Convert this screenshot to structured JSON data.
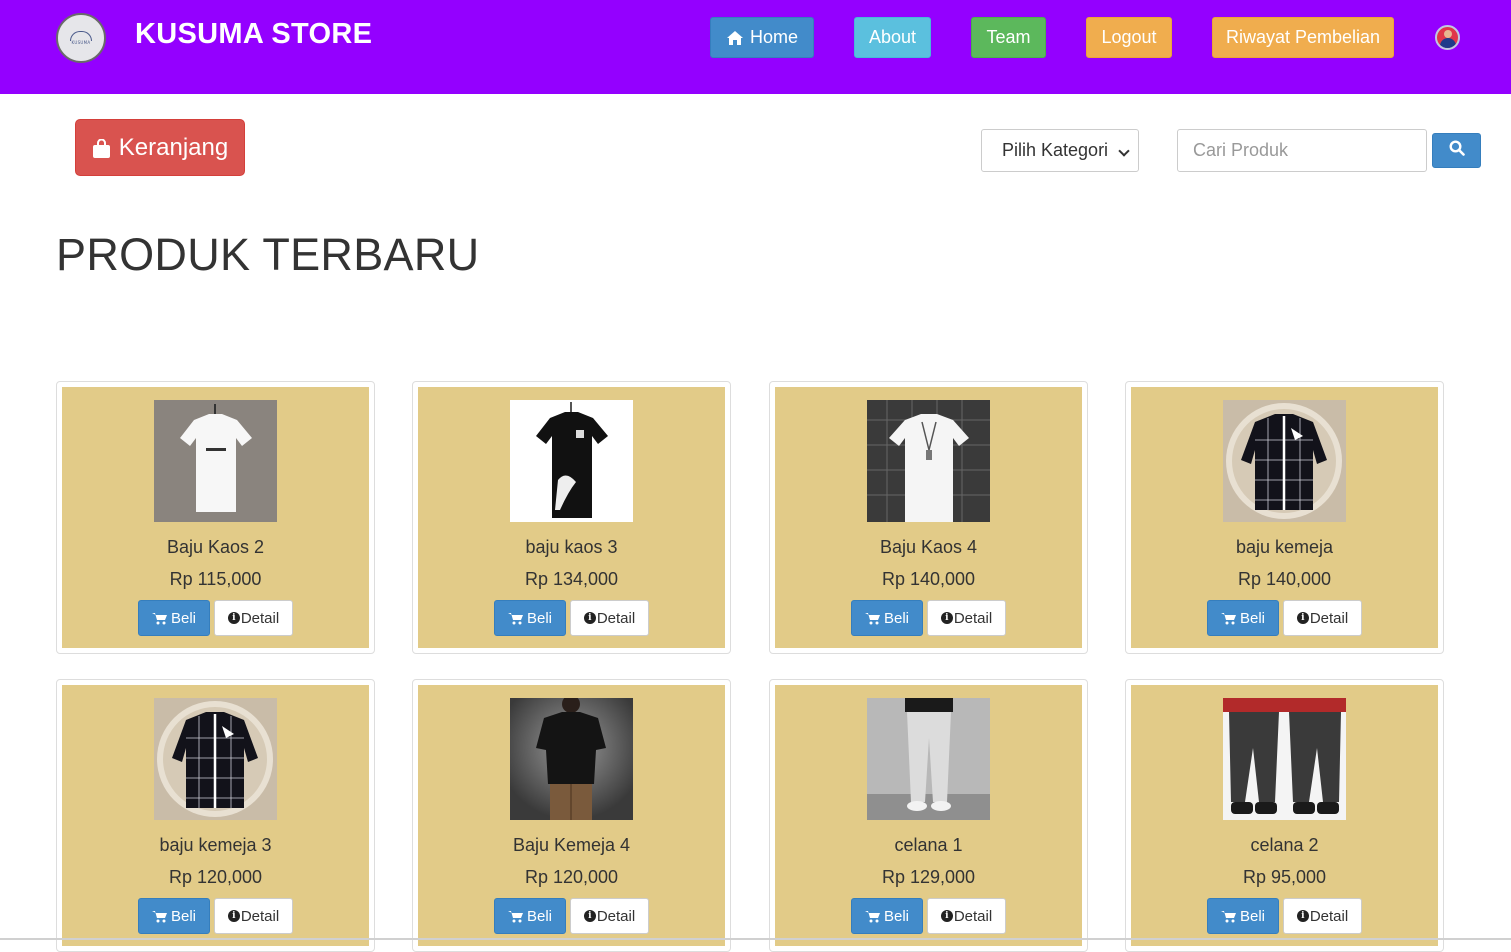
{
  "header": {
    "brand": "KUSUMA STORE",
    "logo_text": "KUSUMA",
    "nav": [
      {
        "label": "Home",
        "color": "#428bca"
      },
      {
        "label": "About",
        "color": "#5bc0de"
      },
      {
        "label": "Team",
        "color": "#5cb85c"
      },
      {
        "label": "Logout",
        "color": "#f0ad4e"
      },
      {
        "label": "Riwayat Pembelian",
        "color": "#f0ad4e"
      }
    ],
    "background": "#9400ff"
  },
  "toolbar": {
    "cart_label": "Keranjang",
    "category_select": {
      "selected": "Pilih Kategori"
    },
    "search": {
      "placeholder": "Cari Produk",
      "value": ""
    }
  },
  "main": {
    "title": "PRODUK TERBARU",
    "products": [
      {
        "name": "Baju Kaos 2",
        "price": "Rp 115,000",
        "buy_label": "Beli",
        "detail_label": "Detail"
      },
      {
        "name": "baju kaos 3",
        "price": "Rp 134,000",
        "buy_label": "Beli",
        "detail_label": "Detail"
      },
      {
        "name": "Baju Kaos 4",
        "price": "Rp 140,000",
        "buy_label": "Beli",
        "detail_label": "Detail"
      },
      {
        "name": "baju kemeja",
        "price": "Rp 140,000",
        "buy_label": "Beli",
        "detail_label": "Detail"
      },
      {
        "name": "baju kemeja 3",
        "price": "Rp 120,000",
        "buy_label": "Beli",
        "detail_label": "Detail"
      },
      {
        "name": "Baju Kemeja 4",
        "price": "Rp 120,000",
        "buy_label": "Beli",
        "detail_label": "Detail"
      },
      {
        "name": "celana 1",
        "price": "Rp 129,000",
        "buy_label": "Beli",
        "detail_label": "Detail"
      },
      {
        "name": "celana 2",
        "price": "Rp 95,000",
        "buy_label": "Beli",
        "detail_label": "Detail"
      }
    ],
    "card_color": "#e2cb88"
  }
}
